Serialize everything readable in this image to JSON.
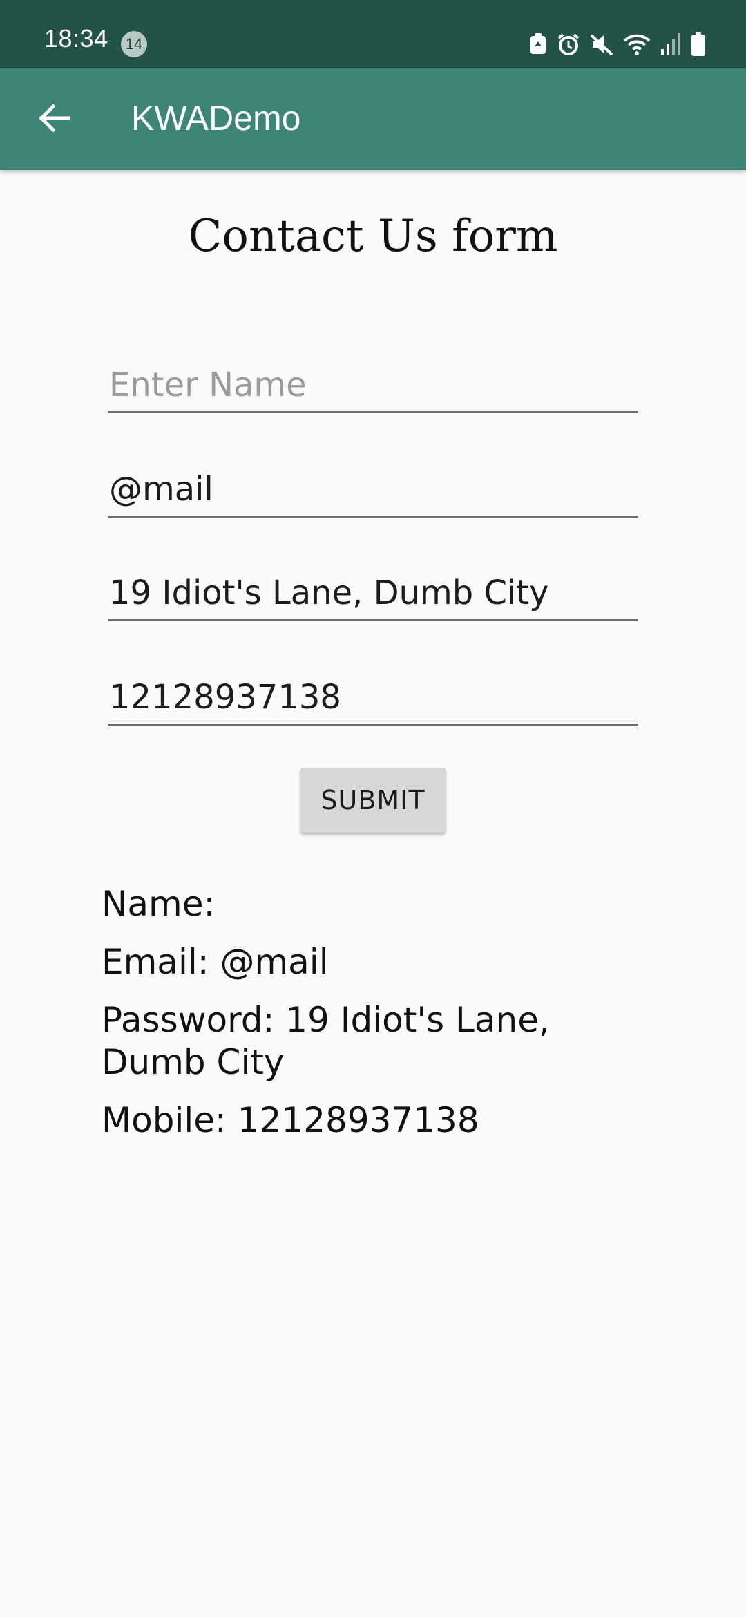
{
  "status_bar": {
    "time": "18:34",
    "notification_count": "14",
    "icons": [
      "recycle-icon",
      "alarm-icon",
      "mute-icon",
      "wifi-icon",
      "signal-icon",
      "battery-icon"
    ]
  },
  "app_bar": {
    "title": "KWADemo",
    "background": "#3d8577",
    "status_background": "#235347"
  },
  "form": {
    "title": "Contact Us form",
    "name_field": {
      "value": "",
      "placeholder": "Enter Name"
    },
    "email_field": {
      "value": "@mail"
    },
    "address_field": {
      "value": "19 Idiot's Lane, Dumb City"
    },
    "mobile_field": {
      "value": "12128937138"
    },
    "submit_label": "SUBMIT"
  },
  "results": {
    "name": "Name:",
    "email": "Email: @mail",
    "password": "Password: 19 Idiot's Lane, Dumb City",
    "mobile": "Mobile: 12128937138"
  }
}
